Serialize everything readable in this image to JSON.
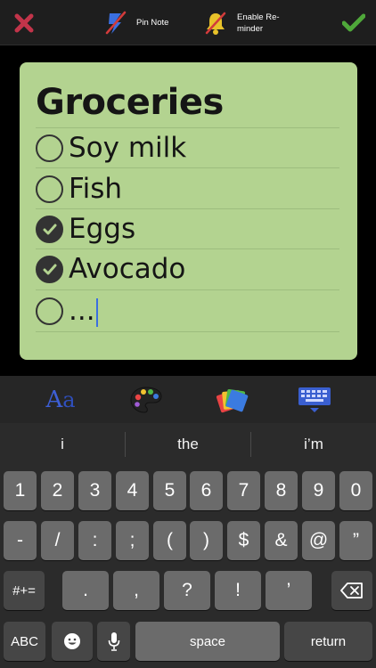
{
  "toolbar": {
    "close_icon": "close-x-icon",
    "pin_label": "Pin Note",
    "reminder_label": "Enable Re-minder",
    "done_icon": "checkmark-icon",
    "colors": {
      "close": "#c2344a",
      "done": "#4fa83a",
      "pin": "#3b6fe0",
      "reminder": "#e8c22a"
    }
  },
  "note": {
    "title": "Groceries",
    "background": "#b3d390",
    "items": [
      {
        "text": "Soy milk",
        "checked": false
      },
      {
        "text": "Fish",
        "checked": false
      },
      {
        "text": "Eggs",
        "checked": true
      },
      {
        "text": "Avocado",
        "checked": true
      },
      {
        "text": "...",
        "checked": false
      }
    ]
  },
  "accessory": {
    "font_label_1": "A",
    "font_label_2": "a",
    "icons": [
      "font-style-icon",
      "palette-icon",
      "note-color-icon",
      "keyboard-hide-icon"
    ]
  },
  "keyboard": {
    "suggestions": [
      "i",
      "the",
      "i’m"
    ],
    "row1": [
      "1",
      "2",
      "3",
      "4",
      "5",
      "6",
      "7",
      "8",
      "9",
      "0"
    ],
    "row2": [
      "-",
      "/",
      ":",
      ";",
      "(",
      ")",
      "$",
      "&",
      "@",
      "”"
    ],
    "row3": [
      ".",
      ",",
      "?",
      "!",
      "’"
    ],
    "shift_label": "#+=",
    "abc_label": "ABC",
    "space_label": "space",
    "return_label": "return"
  }
}
